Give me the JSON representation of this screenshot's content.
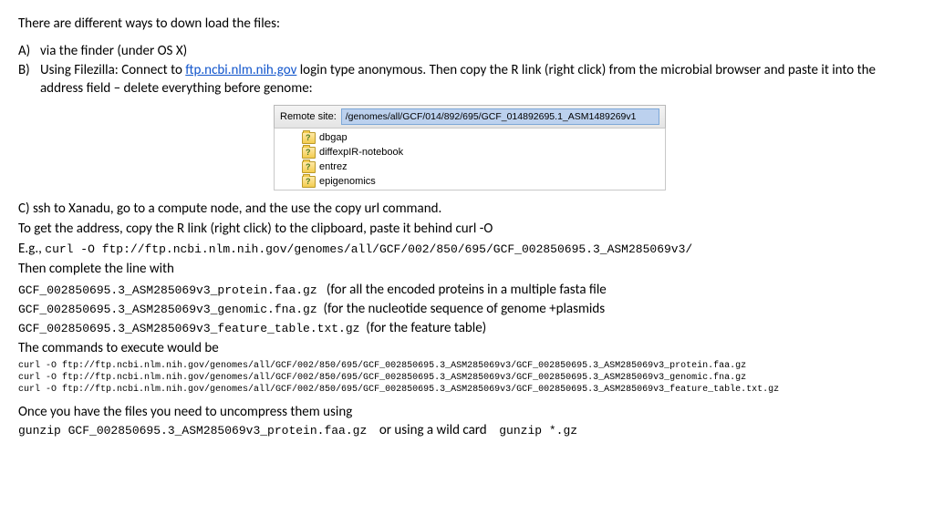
{
  "intro": "There are different ways to down load the files:",
  "option_a": {
    "letter": "A)",
    "text": "via the finder (under OS X)"
  },
  "option_b": {
    "letter": "B)",
    "pre": "Using Filezilla:  Connect to ",
    "link": "ftp.ncbi.nlm.nih.gov",
    "post": " login type anonymous. Then copy the R link (right click) from the microbial browser and paste it into the address field – delete everything before genome:"
  },
  "filezilla": {
    "label": "Remote site:",
    "path": "/genomes/all/GCF/014/892/695/GCF_014892695.1_ASM1489269v1",
    "items": [
      "dbgap",
      "diffexpIR-notebook",
      "entrez",
      "epigenomics"
    ]
  },
  "option_c": {
    "line1": "C) ssh to Xanadu, go to a compute node, and the use the copy url command.",
    "line2": "To get the address, copy the R link (right click) to the clipboard, paste it behind curl -O",
    "eg_label": "E.g.,",
    "eg_cmd": "curl -O ftp://ftp.ncbi.nlm.nih.gov/genomes/all/GCF/002/850/695/GCF_002850695.3_ASM285069v3/",
    "then": "Then complete the line with"
  },
  "files": {
    "f1": "GCF_002850695.3_ASM285069v3_protein.faa.gz",
    "f1_desc": "(for all the encoded proteins in a multiple fasta file",
    "f2": "GCF_002850695.3_ASM285069v3_genomic.fna.gz",
    "f2_desc": "(for the nucleotide sequence of genome +plasmids",
    "f3": "GCF_002850695.3_ASM285069v3_feature_table.txt.gz",
    "f3_desc": "(for the feature table)"
  },
  "cmds": {
    "intro": "The commands to execute would be",
    "c1": "curl -O ftp://ftp.ncbi.nlm.nih.gov/genomes/all/GCF/002/850/695/GCF_002850695.3_ASM285069v3/GCF_002850695.3_ASM285069v3_protein.faa.gz",
    "c2": "curl -O ftp://ftp.ncbi.nlm.nih.gov/genomes/all/GCF/002/850/695/GCF_002850695.3_ASM285069v3/GCF_002850695.3_ASM285069v3_genomic.fna.gz",
    "c3": "curl -O ftp://ftp.ncbi.nlm.nih.gov/genomes/all/GCF/002/850/695/GCF_002850695.3_ASM285069v3/GCF_002850695.3_ASM285069v3_feature_table.txt.gz"
  },
  "uncompress": {
    "intro": "Once you have the files you need to uncompress them using",
    "cmd": "gunzip GCF_002850695.3_ASM285069v3_protein.faa.gz",
    "or": "or using a wild card",
    "wild": "gunzip *.gz"
  }
}
